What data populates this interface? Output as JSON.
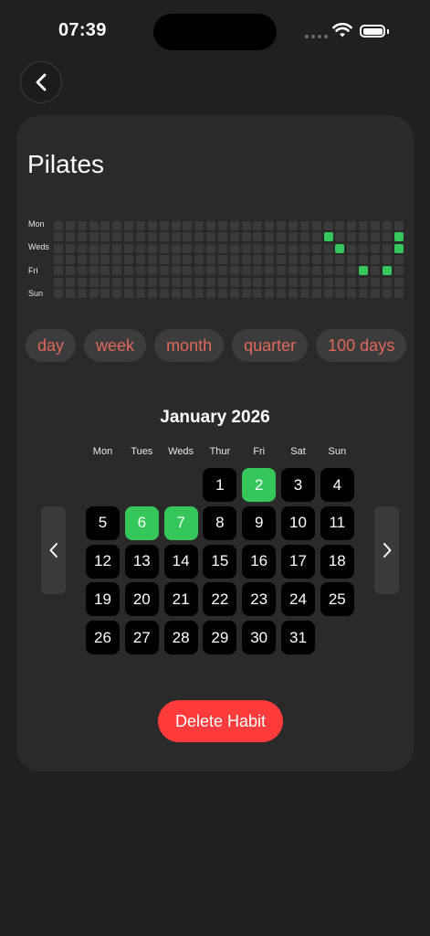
{
  "status_bar": {
    "time": "07:39"
  },
  "habit": {
    "name": "Pilates"
  },
  "heatmap": {
    "day_labels": [
      "Mon",
      "Weds",
      "Fri",
      "Sun"
    ],
    "weeks": 30,
    "days_per_week": 7,
    "completed": [
      {
        "week": 24,
        "day": 1
      },
      {
        "week": 25,
        "day": 2
      },
      {
        "week": 27,
        "day": 4
      },
      {
        "week": 29,
        "day": 4
      },
      {
        "week": 30,
        "day": 1
      },
      {
        "week": 30,
        "day": 2
      }
    ],
    "on_color": "#35c759",
    "off_color": "#3a3a3a"
  },
  "periods": [
    "day",
    "week",
    "month",
    "quarter",
    "100 days"
  ],
  "calendar": {
    "title": "January 2026",
    "weekdays": [
      "Mon",
      "Tues",
      "Weds",
      "Thur",
      "Fri",
      "Sat",
      "Sun"
    ],
    "first_weekday_index": 3,
    "days_in_month": 31,
    "completed_days": [
      2,
      6,
      7
    ]
  },
  "actions": {
    "delete_label": "Delete Habit"
  },
  "colors": {
    "accent_green": "#35c759",
    "delete_red": "#ff3b3b",
    "chip_text": "#e0685a"
  }
}
